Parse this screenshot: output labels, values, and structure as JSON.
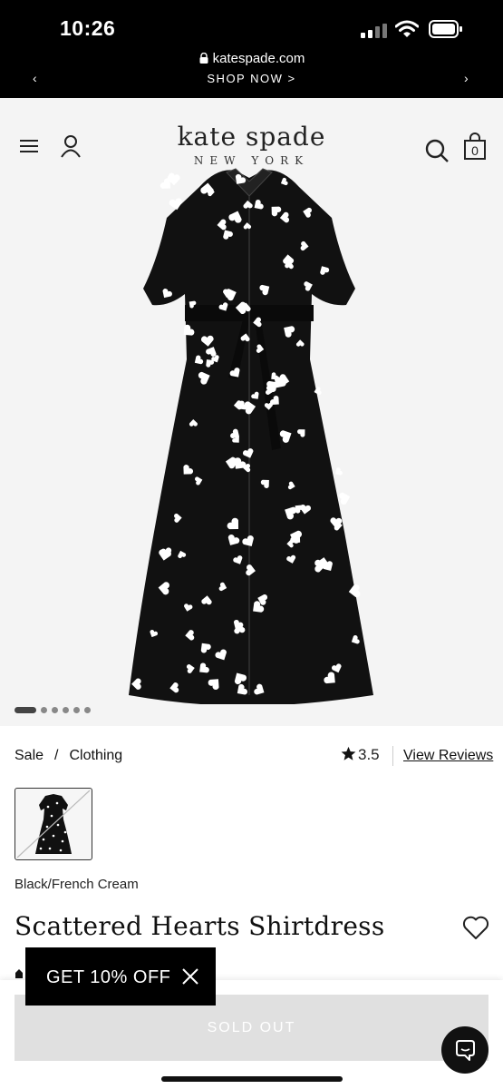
{
  "status_bar": {
    "time": "10:26"
  },
  "browser": {
    "url": "katespade.com",
    "promo": "SHOP NOW >",
    "prev_arrow": "‹",
    "next_arrow": "›"
  },
  "header": {
    "logo": "kate spade",
    "logo_sub": "NEW YORK",
    "bag_count": "0"
  },
  "gallery": {
    "image_count": 6,
    "active_index": 0
  },
  "product": {
    "breadcrumb": {
      "sale": "Sale",
      "separator": "/",
      "category": "Clothing"
    },
    "rating": "3.5",
    "reviews_link": "View Reviews",
    "color_name": "Black/French Cream",
    "title": "Scattered Hearts Shirtdress"
  },
  "actions": {
    "sold_out": "SOLD OUT"
  },
  "offer": {
    "label": "GET 10% OFF"
  },
  "colors": {
    "bar": "#000000",
    "hero_bg": "#f4f4f4",
    "sold_out_bg": "#e0e0e0",
    "dress": "#111111",
    "hearts": "#ffffff"
  }
}
